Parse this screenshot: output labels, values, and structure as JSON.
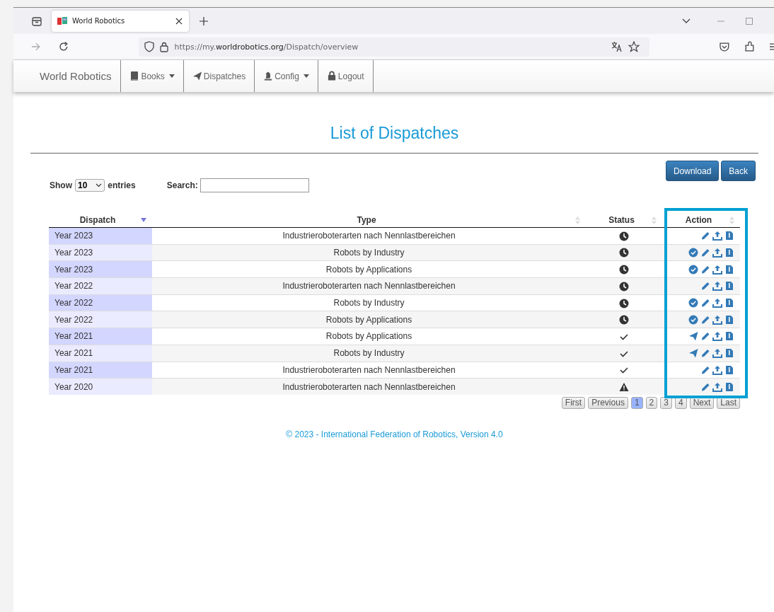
{
  "browser": {
    "tab_title": "World Robotics",
    "url_prefix": "https://my.",
    "url_domain": "worldrobotics.org",
    "url_path": "/Dispatch/overview"
  },
  "navbar": {
    "brand": "World Robotics",
    "items": [
      {
        "label": "Books",
        "kind": "book",
        "dropdown": true
      },
      {
        "label": "Dispatches",
        "kind": "plane",
        "dropdown": false
      },
      {
        "label": "Config",
        "kind": "chess",
        "dropdown": true
      },
      {
        "label": "Logout",
        "kind": "lock",
        "dropdown": false
      }
    ]
  },
  "page_title": "List of Dispatches",
  "buttons": [
    "Download",
    "Back"
  ],
  "length_control": {
    "prefix": "Show",
    "value": "10",
    "suffix": "entries"
  },
  "search": {
    "label": "Search:"
  },
  "table": {
    "columns": [
      {
        "label": "Dispatch",
        "kind": "desc"
      },
      {
        "label": "Type",
        "kind": "unsorted"
      },
      {
        "label": "Status",
        "kind": "unsorted"
      },
      {
        "label": "Action",
        "kind": "unsorted"
      }
    ],
    "rows": [
      {
        "dispatch": "Year 2023",
        "type": "Industrieroboterarten nach Nennlastbereichen",
        "status": {
          "kind": "clock"
        },
        "actions": [
          {
            "kind": "edit"
          },
          {
            "kind": "upload"
          },
          {
            "kind": "file"
          }
        ]
      },
      {
        "dispatch": "Year 2023",
        "type": "Robots by Industry",
        "status": {
          "kind": "clock"
        },
        "actions": [
          {
            "kind": "approve"
          },
          {
            "kind": "edit"
          },
          {
            "kind": "upload"
          },
          {
            "kind": "file"
          }
        ]
      },
      {
        "dispatch": "Year 2023",
        "type": "Robots by Applications",
        "status": {
          "kind": "clock"
        },
        "actions": [
          {
            "kind": "approve"
          },
          {
            "kind": "edit"
          },
          {
            "kind": "upload"
          },
          {
            "kind": "file"
          }
        ]
      },
      {
        "dispatch": "Year 2022",
        "type": "Industrieroboterarten nach Nennlastbereichen",
        "status": {
          "kind": "clock"
        },
        "actions": [
          {
            "kind": "edit"
          },
          {
            "kind": "upload"
          },
          {
            "kind": "file"
          }
        ]
      },
      {
        "dispatch": "Year 2022",
        "type": "Robots by Industry",
        "status": {
          "kind": "clock"
        },
        "actions": [
          {
            "kind": "approve"
          },
          {
            "kind": "edit"
          },
          {
            "kind": "upload"
          },
          {
            "kind": "file"
          }
        ]
      },
      {
        "dispatch": "Year 2022",
        "type": "Robots by Applications",
        "status": {
          "kind": "clock"
        },
        "actions": [
          {
            "kind": "approve"
          },
          {
            "kind": "edit"
          },
          {
            "kind": "upload"
          },
          {
            "kind": "file"
          }
        ]
      },
      {
        "dispatch": "Year 2021",
        "type": "Robots by Applications",
        "status": {
          "kind": "check"
        },
        "actions": [
          {
            "kind": "send"
          },
          {
            "kind": "edit"
          },
          {
            "kind": "upload"
          },
          {
            "kind": "file"
          }
        ]
      },
      {
        "dispatch": "Year 2021",
        "type": "Robots by Industry",
        "status": {
          "kind": "check"
        },
        "actions": [
          {
            "kind": "send"
          },
          {
            "kind": "edit"
          },
          {
            "kind": "upload"
          },
          {
            "kind": "file"
          }
        ]
      },
      {
        "dispatch": "Year 2021",
        "type": "Industrieroboterarten nach Nennlastbereichen",
        "status": {
          "kind": "check"
        },
        "actions": [
          {
            "kind": "edit"
          },
          {
            "kind": "upload"
          },
          {
            "kind": "file"
          }
        ]
      },
      {
        "dispatch": "Year 2020",
        "type": "Industrieroboterarten nach Nennlastbereichen",
        "status": {
          "kind": "warning"
        },
        "actions": [
          {
            "kind": "edit"
          },
          {
            "kind": "upload"
          },
          {
            "kind": "file"
          }
        ]
      }
    ]
  },
  "pagination": [
    {
      "label": "First",
      "selected": false
    },
    {
      "label": "Previous",
      "selected": false
    },
    {
      "label": "1",
      "selected": true
    },
    {
      "label": "2",
      "selected": false
    },
    {
      "label": "3",
      "selected": false
    },
    {
      "label": "4",
      "selected": false
    },
    {
      "label": "Next",
      "selected": false
    },
    {
      "label": "Last",
      "selected": false
    }
  ],
  "footer": "© 2023 - International Federation of Robotics, Version 4.0"
}
